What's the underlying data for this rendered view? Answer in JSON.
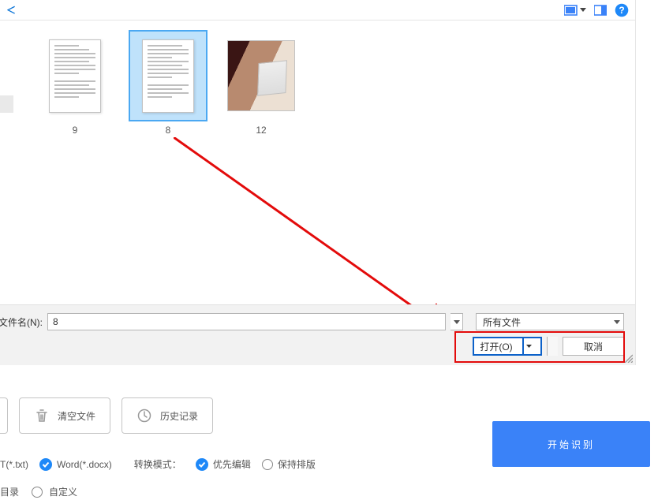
{
  "dialog": {
    "title_char": "＜",
    "thumbs": [
      {
        "label": "9"
      },
      {
        "label": "8"
      },
      {
        "label": "12"
      }
    ],
    "filename_label": "文件名(N):",
    "filename_value": "8",
    "filetype_value": "所有文件",
    "open_label": "打开(O)",
    "cancel_label": "取消"
  },
  "panel": {
    "clear_label": "清空文件",
    "history_label": "历史记录",
    "txt_label": "T(*.txt)",
    "word_label": "Word(*.docx)",
    "convert_mode_label": "转换模式：",
    "prefer_edit_label": "优先编辑",
    "keep_layout_label": "保持排版",
    "dir_label": "目录",
    "custom_label": "自定义",
    "start_label": "开始识别"
  }
}
